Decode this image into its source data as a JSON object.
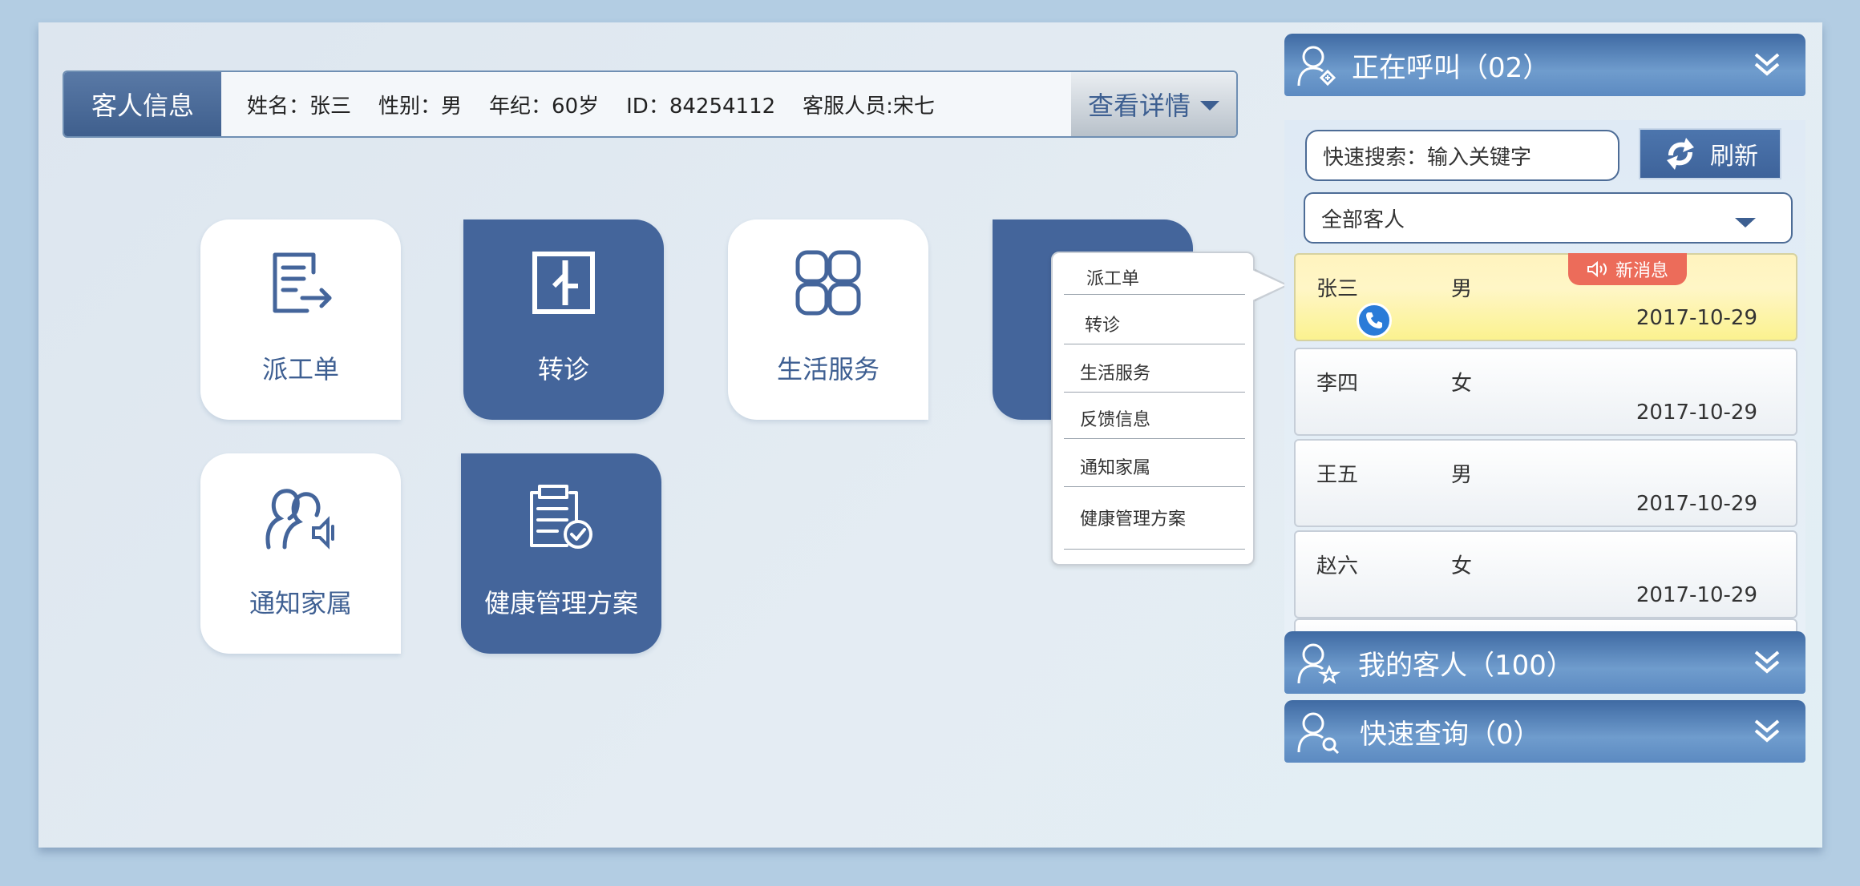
{
  "info_bar": {
    "label": "客人信息",
    "name": "姓名：张三",
    "gender": "性别：男",
    "age": "年纪：60岁",
    "id": "ID：84254112",
    "staff": "客服人员:宋七",
    "detail_button": "查看详情"
  },
  "tiles": {
    "dispatch": "派工单",
    "referral": "转诊",
    "life_service": "生活服务",
    "notify_family": "通知家属",
    "health_plan": "健康管理方案"
  },
  "popup_menu": [
    "派工单",
    "转诊",
    "生活服务",
    "反馈信息",
    "通知家属",
    "健康管理方案"
  ],
  "calling_panel": {
    "title": "正在呼叫（02）",
    "search_placeholder": "快速搜索：输入关键字",
    "refresh_label": "刷新",
    "filter_selected": "全部客人",
    "new_message_badge": "新消息",
    "rows": [
      {
        "name": "张三",
        "gender": "男",
        "date": "2017-10-29"
      },
      {
        "name": "李四",
        "gender": "女",
        "date": "2017-10-29"
      },
      {
        "name": "王五",
        "gender": "男",
        "date": "2017-10-29"
      },
      {
        "name": "赵六",
        "gender": "女",
        "date": "2017-10-29"
      }
    ]
  },
  "my_customers_panel": {
    "title": "我的客人（100）"
  },
  "quick_query_panel": {
    "title": "快速查询（0）"
  },
  "colors": {
    "primary_blue": "#44659b",
    "header_gradient_top": "#3f6aa3",
    "new_badge": "#ec6c5a",
    "active_row": "#fff4bf"
  }
}
